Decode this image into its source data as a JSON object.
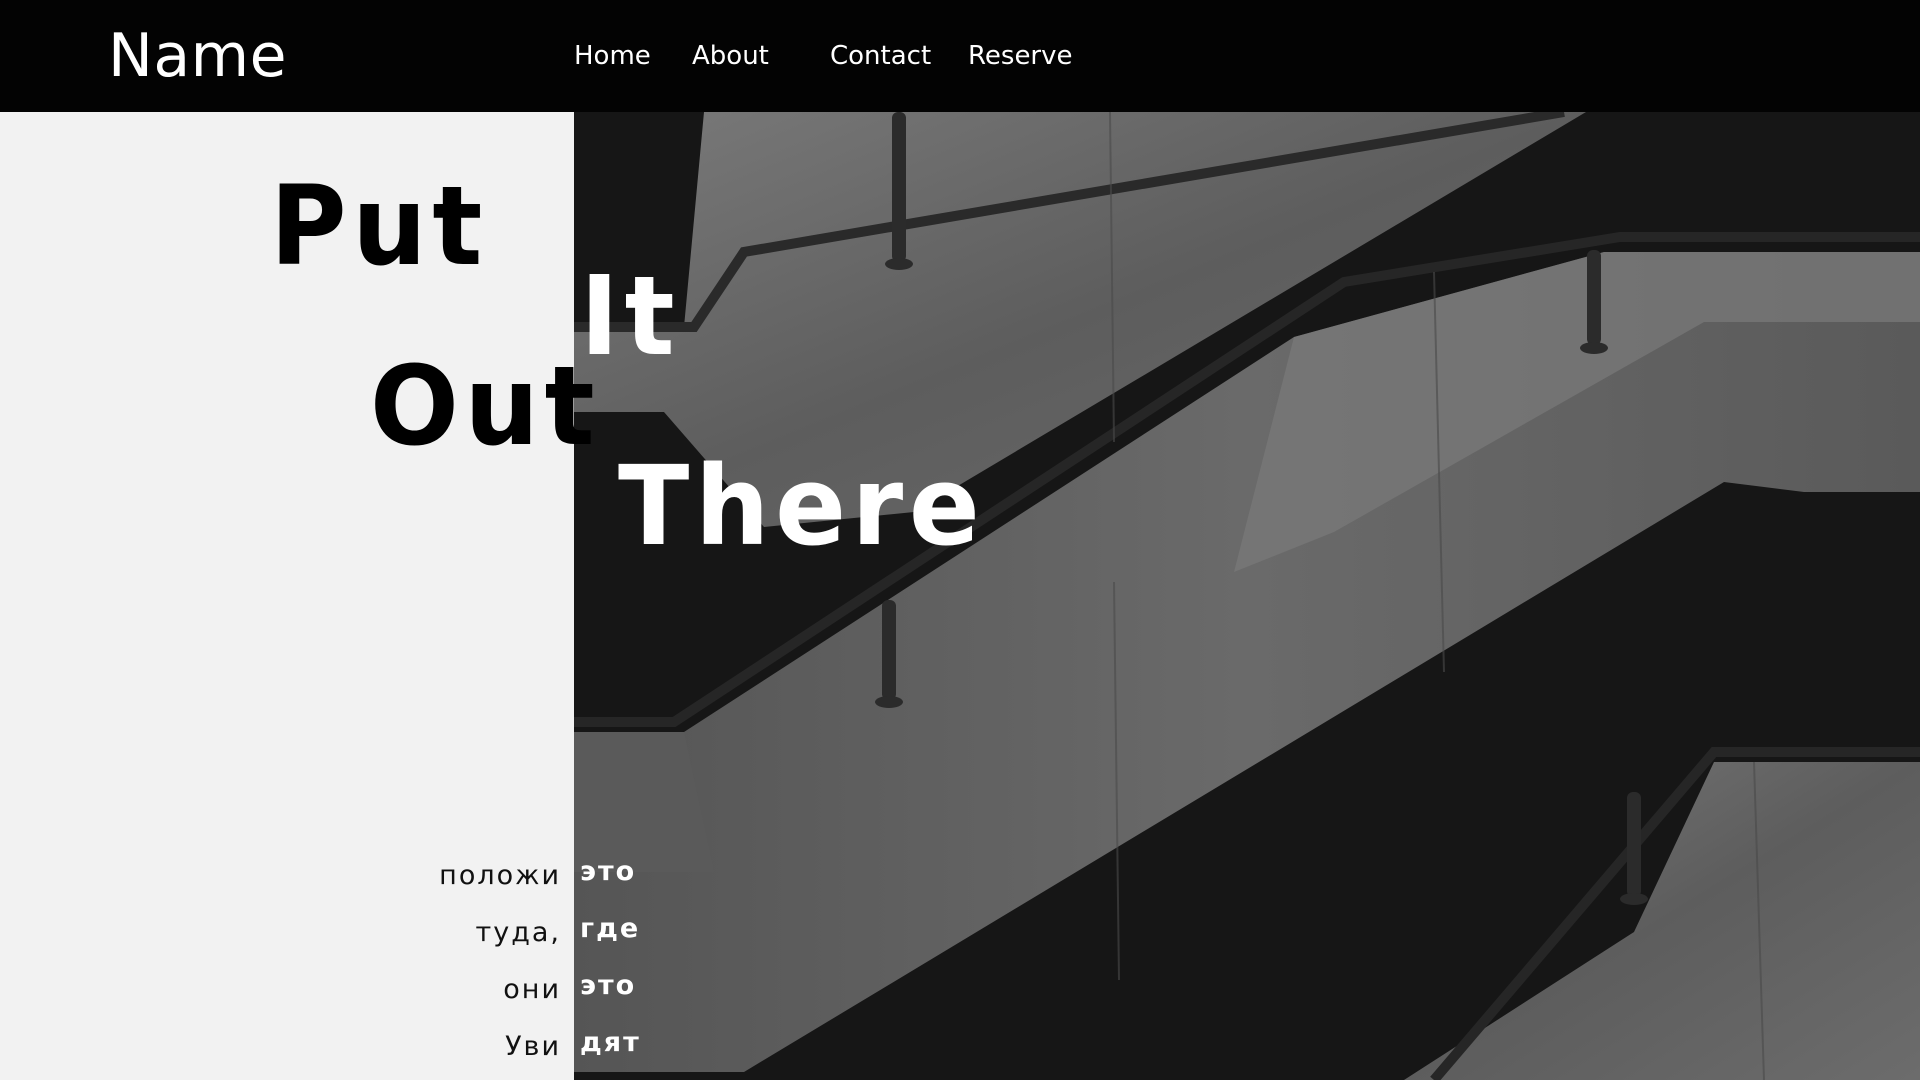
{
  "header": {
    "brand": "Name",
    "nav": [
      {
        "label": "Home"
      },
      {
        "label": "About"
      },
      {
        "label": "Contact"
      },
      {
        "label": "Reserve"
      }
    ]
  },
  "hero": {
    "words": [
      "Put",
      "It",
      "Out",
      "There"
    ],
    "russian_left": [
      "положи",
      "туда,",
      "они",
      "Уви"
    ],
    "russian_right": [
      "это",
      "где",
      "это",
      "дят"
    ]
  },
  "colors": {
    "header_bg": "#030303",
    "panel_bg": "#f2f2f2",
    "photo_dark": "#161616",
    "concrete": "#6e6e6e"
  },
  "image": {
    "subject": "concrete staircase railings photo (grayscale)"
  }
}
